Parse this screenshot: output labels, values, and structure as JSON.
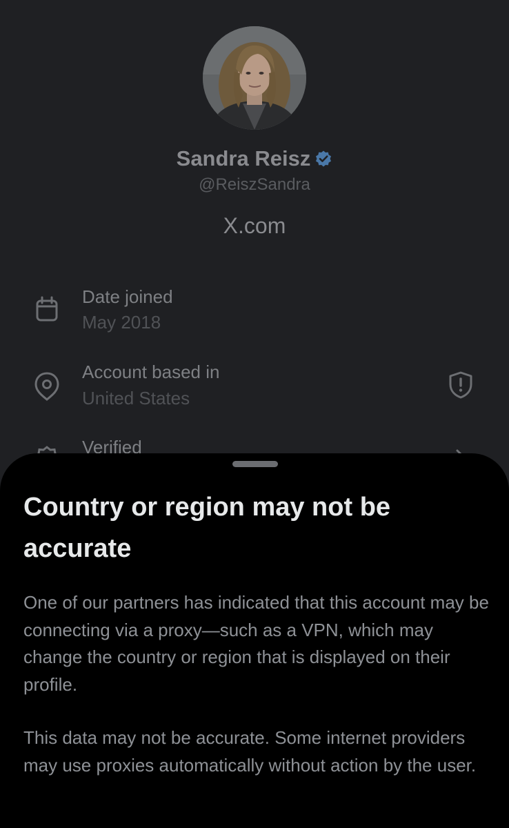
{
  "profile": {
    "name": "Sandra Reisz",
    "handle": "@ReiszSandra",
    "domain": "X.com",
    "verified": true
  },
  "details": {
    "date_joined_label": "Date joined",
    "date_joined_value": "May 2018",
    "account_based_label": "Account based in",
    "account_based_value": "United States",
    "verified_label": "Verified"
  },
  "icons": {
    "calendar": "calendar-icon",
    "location": "location-pin-icon",
    "shield": "shield-alert-icon",
    "verified": "verified-badge-icon",
    "chevron": "chevron-right-icon"
  },
  "sheet": {
    "title": "Country or region may not be accurate",
    "paragraph_1": "One of our partners has indicated that this account may be connecting via a proxy—such as a VPN, which may change the country or region that is displayed on their profile.",
    "paragraph_2": "This data may not be accurate. Some internet providers may use proxies automatically without action by the user."
  },
  "colors": {
    "background": "#1f2023",
    "sheet_background": "#000000",
    "verified_blue": "#4a78a8",
    "title_text": "#e7e9ea",
    "body_text": "#8e9196"
  }
}
